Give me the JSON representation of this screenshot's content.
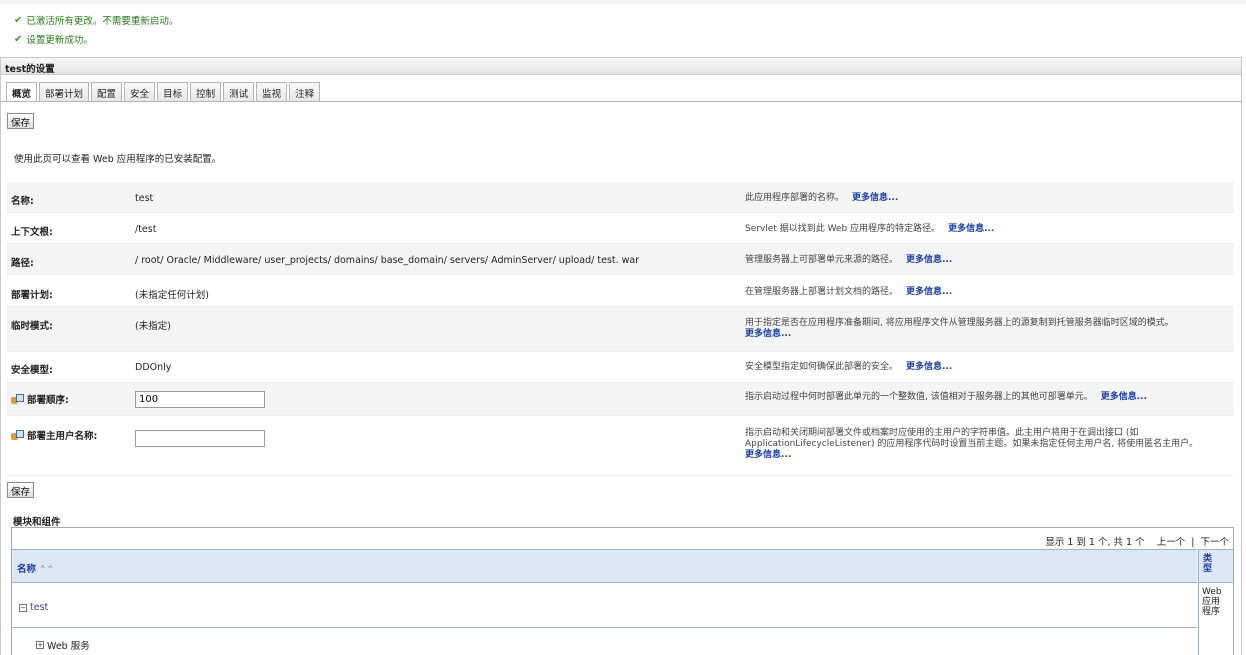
{
  "messages": [
    "已激活所有更改。不需要重新启动。",
    "设置更新成功。"
  ],
  "panel": {
    "title": "test的设置"
  },
  "tabs": [
    "概览",
    "部署计划",
    "配置",
    "安全",
    "目标",
    "控制",
    "测试",
    "监视",
    "注释"
  ],
  "save_label": "保存",
  "description": "使用此页可以查看 Web 应用程序的已安装配置。",
  "more_info": "更多信息...",
  "fields": [
    {
      "label": "名称:",
      "value": "test",
      "help": "此应用程序部署的名称。"
    },
    {
      "label": "上下文根:",
      "value": "/test",
      "help": "Servlet 据以找到此 Web 应用程序的特定路径。"
    },
    {
      "label": "路径:",
      "value": "/ root/ Oracle/ Middleware/ user_projects/ domains/ base_domain/ servers/ AdminServer/ upload/ test. war",
      "help": "管理服务器上可部署单元来源的路径。"
    },
    {
      "label": "部署计划:",
      "value": "(未指定任何计划)",
      "help": "在管理服务器上部署计划文档的路径。"
    },
    {
      "label": "临时模式:",
      "value": "(未指定)",
      "help": "用于指定是否在应用程序准备期间, 将应用程序文件从管理服务器上的源复制到托管服务器临时区域的模式。"
    },
    {
      "label": "安全模型:",
      "value": "DDOnly",
      "help": "安全模型指定如何确保此部署的安全。"
    },
    {
      "label": "部署顺序:",
      "value": "100",
      "help": "指示启动过程中何时部署此单元的一个整数值, 该值相对于服务器上的其他可部署单元。"
    },
    {
      "label": "部署主用户名称:",
      "value": "",
      "help": "指示启动和关闭期间部署文件或档案时应使用的主用户的字符串值。此主用户将用于在调出接口 (如 ApplicationLifecycleListener) 的应用程序代码时设置当前主题。如果未指定任何主用户名, 将使用匿名主用户。"
    }
  ],
  "modules": {
    "title": "模块和组件",
    "pager": {
      "info": "显示 1 到 1 个, 共 1 个",
      "prev": "上一个",
      "next": "下一个"
    },
    "col_name": "名称",
    "col_type": "类型",
    "row_name": "test",
    "row_type": "Web 应用程序",
    "child": "Web 服务"
  }
}
